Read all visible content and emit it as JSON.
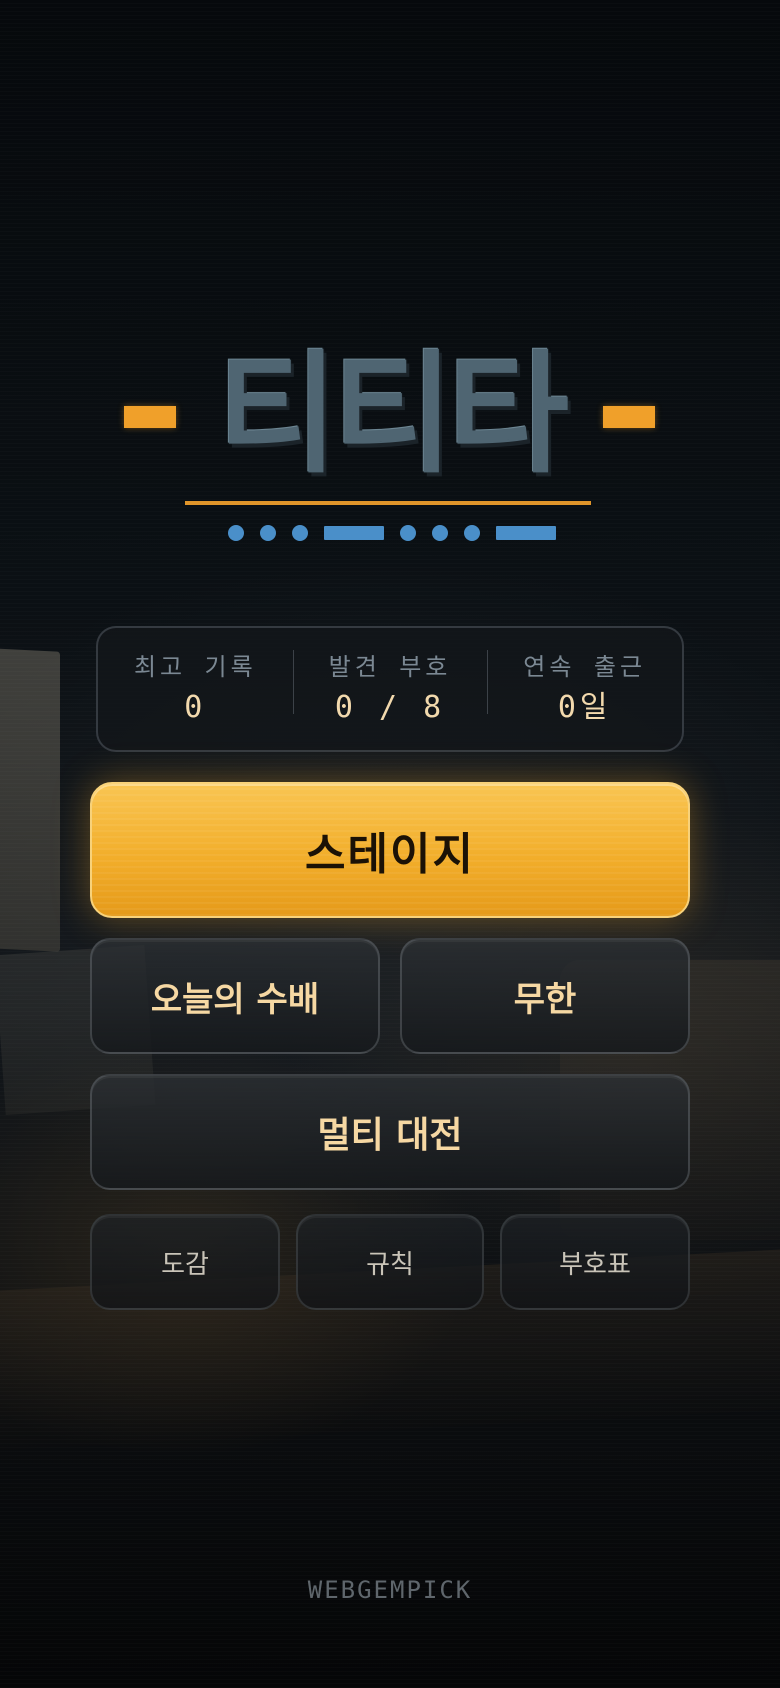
{
  "logo": {
    "title": "티티타",
    "accent_color": "#f0a02a",
    "morse_color": "#4a8fc9",
    "morse_pattern": [
      "dot",
      "dot",
      "dot",
      "dash",
      "dot",
      "dot",
      "dot",
      "dash"
    ]
  },
  "stats": [
    {
      "label": "최고 기록",
      "value": "0"
    },
    {
      "label": "발견 부호",
      "value": "0 / 8"
    },
    {
      "label": "연속 출근",
      "value": "0일"
    }
  ],
  "menu": {
    "stage_label": "스테이지",
    "today_label": "오늘의 수배",
    "infinite_label": "무한",
    "multi_label": "멀티 대전",
    "dex_label": "도감",
    "rules_label": "규칙",
    "symbols_label": "부호표"
  },
  "footer": {
    "brand": "WEBGEMPICK"
  }
}
